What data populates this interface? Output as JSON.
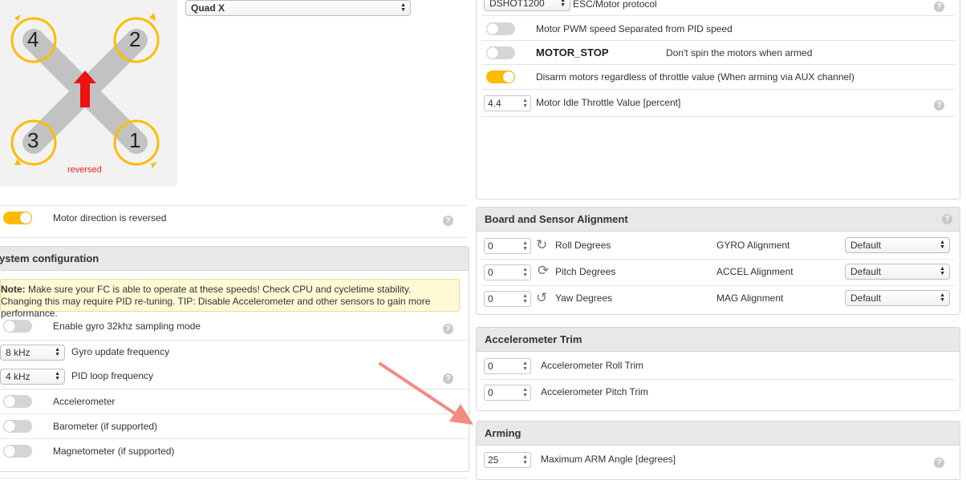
{
  "mixer": {
    "select_value": "Quad X",
    "motor_labels": [
      "4",
      "2",
      "3",
      "1"
    ],
    "reversed_label": "reversed",
    "motor_direction_label": "Motor direction is reversed"
  },
  "system_config": {
    "title": "ystem configuration",
    "note_bold": "Note:",
    "note_text": " Make sure your FC is able to operate at these speeds! Check CPU and cycletime stability. Changing this may require PID re-tuning. TIP: Disable Accelerometer and other sensors to gain more performance.",
    "gyro32_label": "Enable gyro 32khz sampling mode",
    "gyro_freq_value": "8 kHz",
    "gyro_freq_label": "Gyro update frequency",
    "pid_freq_value": "4 kHz",
    "pid_freq_label": "PID loop frequency",
    "accel_label": "Accelerometer",
    "baro_label": "Barometer (if supported)",
    "mag_label": "Magnetometer (if supported)"
  },
  "esc": {
    "protocol_value": "DSHOT1200",
    "protocol_label": "ESC/Motor protocol",
    "pwm_sep_label": "Motor PWM speed Separated from PID speed",
    "motor_stop_label": "MOTOR_STOP",
    "motor_stop_desc": "Don't spin the motors when armed",
    "disarm_label": "Disarm motors regardless of throttle value (When arming via AUX channel)",
    "idle_value": "4.4",
    "idle_label": "Motor Idle Throttle Value [percent]"
  },
  "board_alignment": {
    "title": "Board and Sensor Alignment",
    "roll_value": "0",
    "roll_label": "Roll Degrees",
    "pitch_value": "0",
    "pitch_label": "Pitch Degrees",
    "yaw_value": "0",
    "yaw_label": "Yaw Degrees",
    "gyro_label": "GYRO Alignment",
    "gyro_value": "Default",
    "accel_label": "ACCEL Alignment",
    "accel_value": "Default",
    "mag_label": "MAG Alignment",
    "mag_value": "Default"
  },
  "accel_trim": {
    "title": "Accelerometer Trim",
    "roll_value": "0",
    "roll_label": "Accelerometer Roll Trim",
    "pitch_value": "0",
    "pitch_label": "Accelerometer Pitch Trim"
  },
  "arming": {
    "title": "Arming",
    "angle_value": "25",
    "angle_label": "Maximum ARM Angle [degrees]"
  },
  "help_glyph": "?",
  "colors": {
    "accent": "#ffbb00",
    "annotation_arrow": "#f28b82",
    "note_bg": "#fff9d6"
  }
}
